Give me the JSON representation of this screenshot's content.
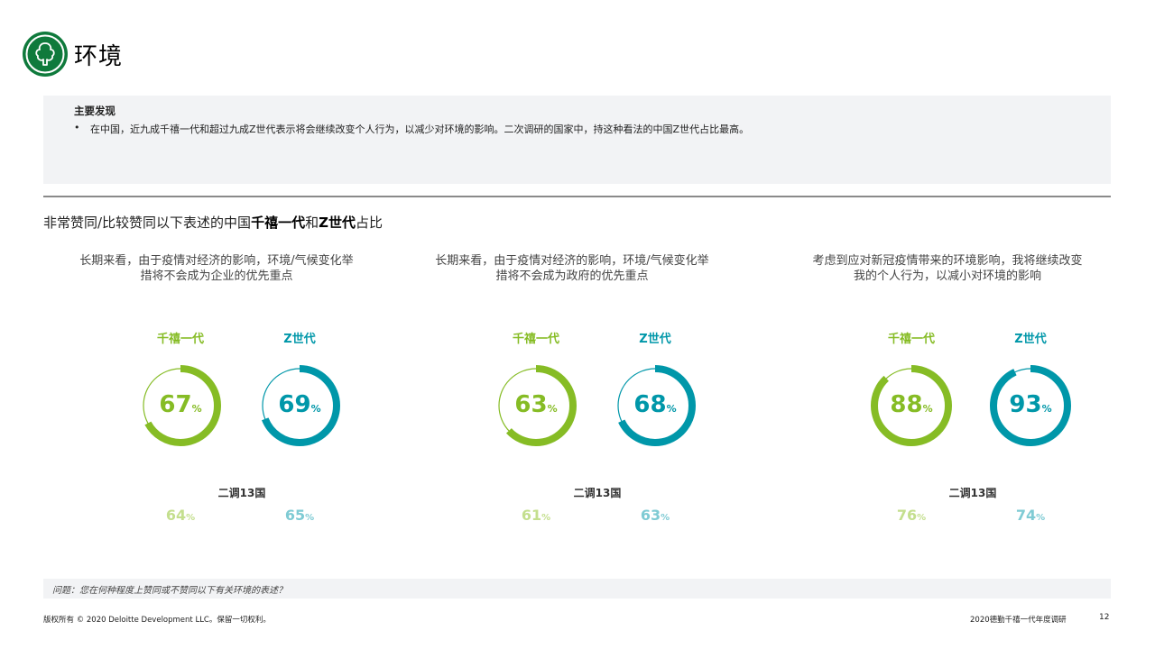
{
  "header": {
    "title": "环境",
    "icon": "tree-icon",
    "icon_color": "#0f7a3c"
  },
  "key_findings": {
    "heading": "主要发现",
    "items": [
      "在中国，近九成千禧一代和超过九成Z世代表示将会继续改变个人行为，以减少对环境的影响。二次调研的国家中，持这种看法的中国Z世代占比最高。"
    ]
  },
  "section": {
    "title_prefix": "非常赞同/比较赞同以下表述的中国",
    "title_bold_1": "千禧一代",
    "title_mid": "和",
    "title_bold_2": "Z世代",
    "title_suffix": "占比"
  },
  "colors": {
    "millennials": "#86bc25",
    "genz": "#0097a9",
    "millennials_light": "#c4df8e",
    "genz_light": "#7fcbd4",
    "ring_track": "#ffffff"
  },
  "labels": {
    "millennials": "千禧一代",
    "genz": "Z世代",
    "comparison": "二调13国",
    "percent_sign": "%"
  },
  "panels": [
    {
      "statement_lines": [
        "长期来看，由于疫情对经济的影响，环境/气候变化举",
        "措将不会成为企业的优先重点"
      ],
      "millennials_value": 67,
      "genz_value": 69,
      "millennials_comparison": 64,
      "genz_comparison": 65
    },
    {
      "statement_lines": [
        "长期来看，由于疫情对经济的影响，环境/气候变化举",
        "措将不会成为政府的优先重点"
      ],
      "millennials_value": 63,
      "genz_value": 68,
      "millennials_comparison": 61,
      "genz_comparison": 63
    },
    {
      "statement_lines": [
        "考虑到应对新冠疫情带来的环境影响，我将继续改变",
        "我的个人行为，以减小对环境的影响"
      ],
      "millennials_value": 88,
      "genz_value": 93,
      "millennials_comparison": 76,
      "genz_comparison": 74
    }
  ],
  "question": "问题：您在何种程度上赞同或不赞同以下有关环境的表述？",
  "footer": {
    "copyright": "版权所有 © 2020 Deloitte Development LLC。保留一切权利。",
    "report_name": "2020德勤千禧一代年度调研",
    "page_number": "12"
  }
}
